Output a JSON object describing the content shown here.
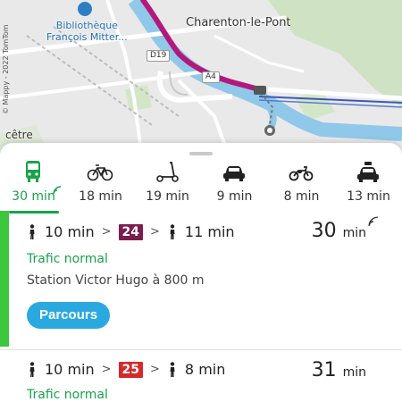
{
  "map": {
    "poi_line1": "Bibliothèque",
    "poi_line2": "François Mitter...",
    "city": "Charenton-le-Pont",
    "road_d19": "D19",
    "road_a4": "A4",
    "partial_label": "cêtre",
    "copyright": "© Mappy - 2022 TomTom"
  },
  "modes": [
    {
      "name": "transit",
      "icon": "bus-icon",
      "time": "30 min",
      "active": true
    },
    {
      "name": "bike",
      "icon": "bicycle-icon",
      "time": "18 min"
    },
    {
      "name": "scooter",
      "icon": "scooter-icon",
      "time": "19 min"
    },
    {
      "name": "car",
      "icon": "car-icon",
      "time": "9 min"
    },
    {
      "name": "motorbike",
      "icon": "motorbike-icon",
      "time": "8 min"
    },
    {
      "name": "taxi",
      "icon": "taxi-icon",
      "time": "13 min"
    }
  ],
  "routes": [
    {
      "walk1": "10 min",
      "line": "24",
      "line_color": "#7b1d4f",
      "walk2": "11 min",
      "duration_value": "30",
      "duration_unit": "min",
      "status": "Trafic normal",
      "station": "Station Victor Hugo à 800 m",
      "button": "Parcours"
    },
    {
      "walk1": "10 min",
      "line": "25",
      "line_color": "#d42a2a",
      "walk2": "8 min",
      "duration_value": "31",
      "duration_unit": "min",
      "status": "Trafic normal"
    }
  ],
  "colors": {
    "accent_green": "#18a34a",
    "bar_green": "#3cc73c",
    "button_blue": "#2aa9e0",
    "route_magenta": "#b3197c"
  }
}
